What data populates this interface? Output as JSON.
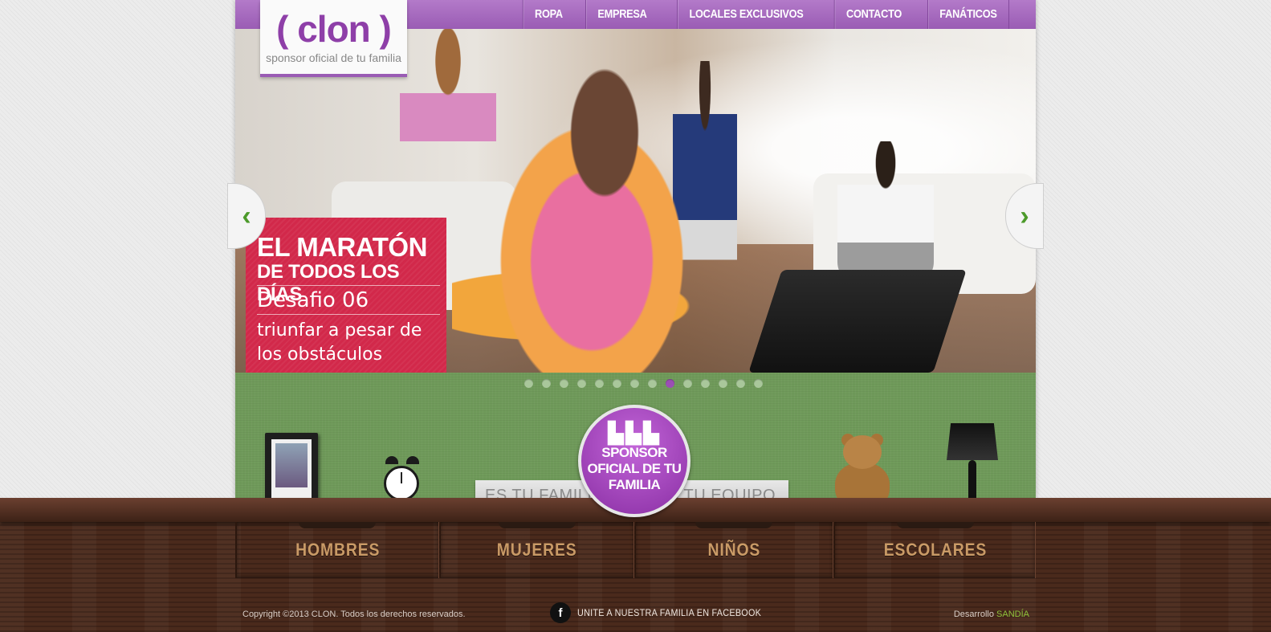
{
  "logo": {
    "mark": "( clon )",
    "tagline": "sponsor oficial de tu familia"
  },
  "nav": [
    "ROPA",
    "EMPRESA",
    "LOCALES EXCLUSIVOS",
    "CONTACTO",
    "FANÁTICOS"
  ],
  "hero": {
    "line1": "EL MARATÓN",
    "line2": "DE TODOS LOS DÍAS",
    "line3": "Desafio 06",
    "line4": "triunfar a pesar de los obstáculos",
    "prev_icon": "chevron-left-icon",
    "next_icon": "chevron-right-icon"
  },
  "slider": {
    "total": 14,
    "active_index": 8
  },
  "badge": {
    "title": "SPONSOR OFICIAL DE TU FAMILIA",
    "left": "ES TU FAMILIA",
    "right": "ES TU EQUIPO"
  },
  "categories": [
    "HOMBRES",
    "MUJERES",
    "NIÑOS",
    "ESCOLARES"
  ],
  "footer": {
    "copyright": "Copyright ©2013 CLON. Todos los derechos reservados.",
    "facebook": "UNITE A NUESTRA FAMILIA EN FACEBOOK",
    "dev_label": "Desarrollo",
    "dev_brand": "SANDÍA"
  },
  "colors": {
    "purple": "#9a5cb4",
    "green": "#6f9a5a",
    "promo_red": "#d2284a",
    "wood": "#4a2a1c",
    "drawer_text": "#c99a66"
  }
}
